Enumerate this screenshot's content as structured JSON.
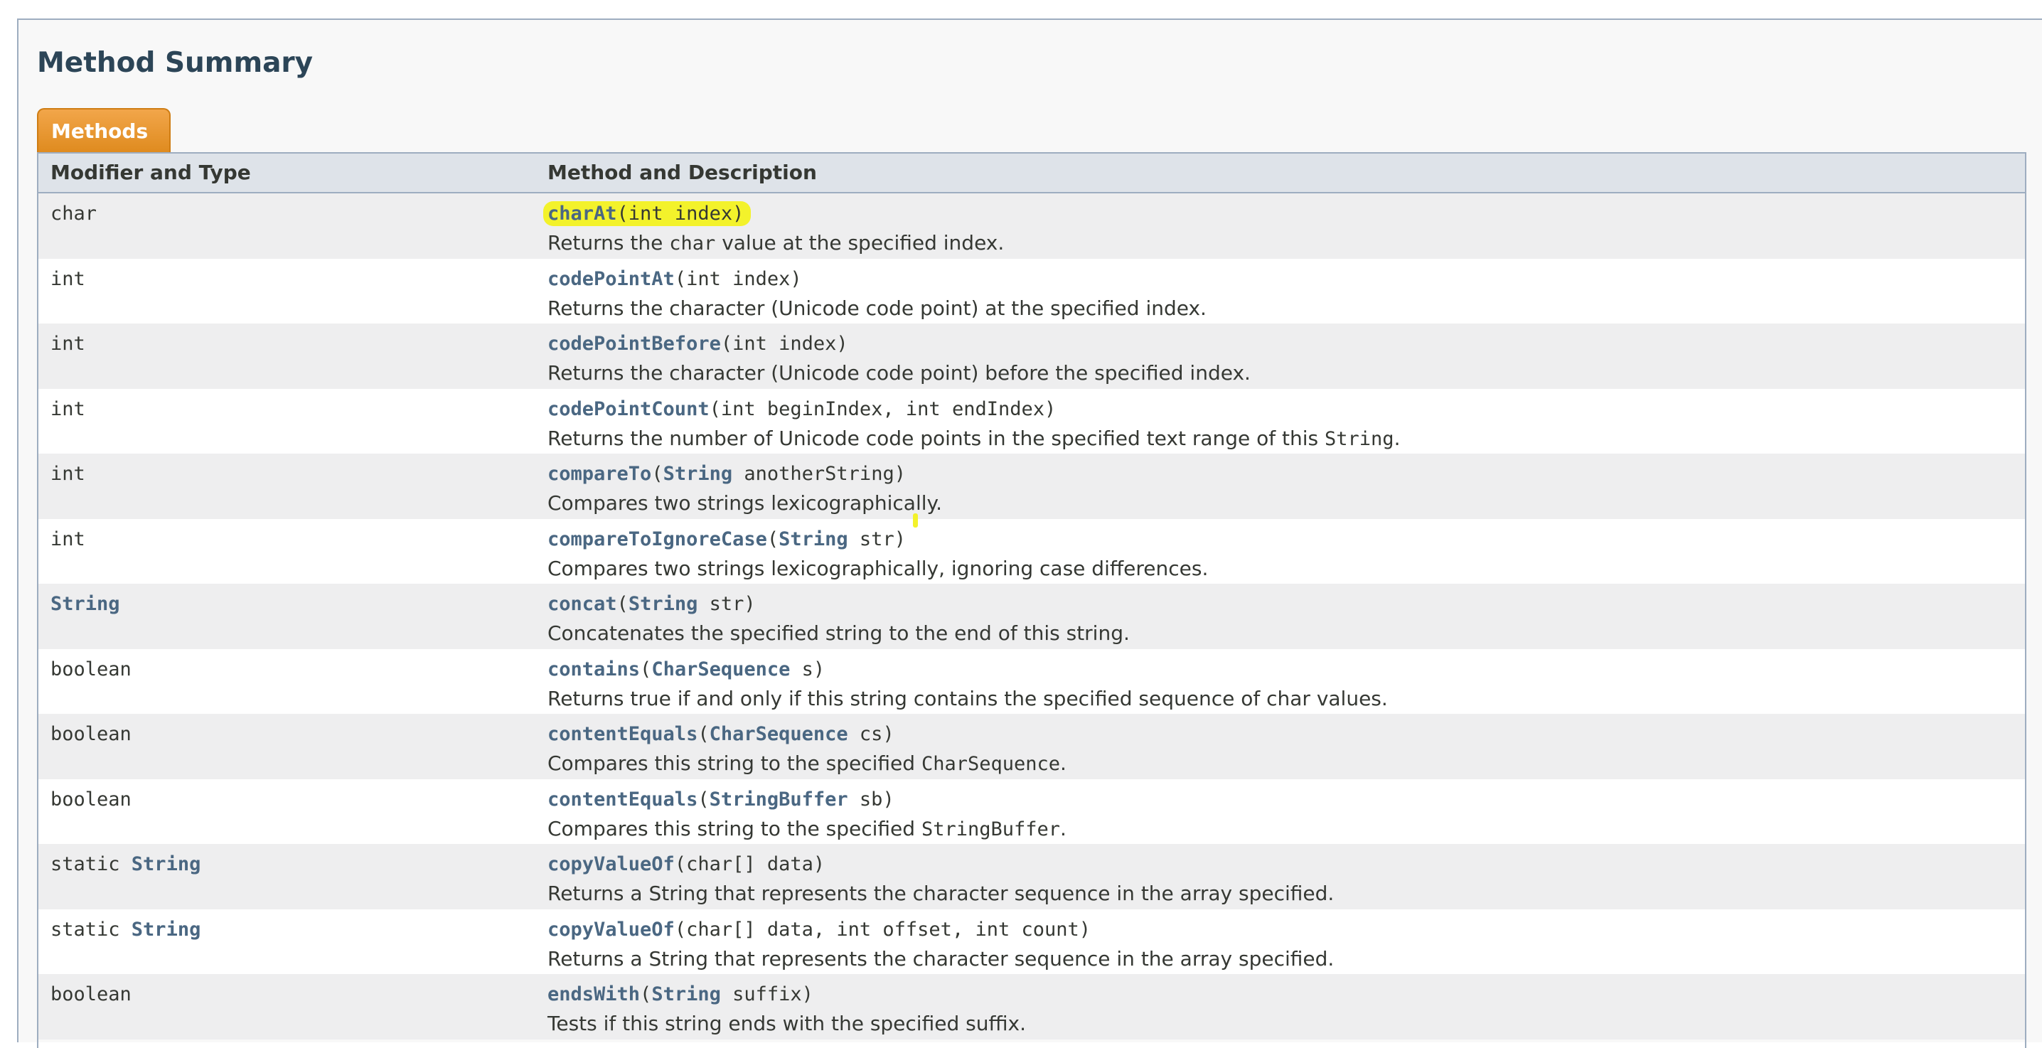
{
  "section": {
    "title": "Method Summary",
    "tab_label": "Methods"
  },
  "table": {
    "headers": [
      "Modifier and Type",
      "Method and Description"
    ],
    "rows": [
      {
        "modifier": [
          {
            "text": "char"
          }
        ],
        "method": [
          {
            "text": "charAt",
            "link": true
          },
          {
            "text": "(int index)"
          }
        ],
        "description": [
          {
            "text": "Returns the "
          },
          {
            "text": "char",
            "code": true
          },
          {
            "text": " value at the specified index."
          }
        ],
        "highlighted": true
      },
      {
        "modifier": [
          {
            "text": "int"
          }
        ],
        "method": [
          {
            "text": "codePointAt",
            "link": true
          },
          {
            "text": "(int index)"
          }
        ],
        "description": [
          {
            "text": "Returns the character (Unicode code point) at the specified index."
          }
        ]
      },
      {
        "modifier": [
          {
            "text": "int"
          }
        ],
        "method": [
          {
            "text": "codePointBefore",
            "link": true
          },
          {
            "text": "(int index)"
          }
        ],
        "description": [
          {
            "text": "Returns the character (Unicode code point) before the specified index."
          }
        ]
      },
      {
        "modifier": [
          {
            "text": "int"
          }
        ],
        "method": [
          {
            "text": "codePointCount",
            "link": true
          },
          {
            "text": "(int beginIndex, int endIndex)"
          }
        ],
        "description": [
          {
            "text": "Returns the number of Unicode code points in the specified text range of this "
          },
          {
            "text": "String",
            "code": true
          },
          {
            "text": "."
          }
        ]
      },
      {
        "modifier": [
          {
            "text": "int"
          }
        ],
        "method": [
          {
            "text": "compareTo",
            "link": true
          },
          {
            "text": "("
          },
          {
            "text": "String",
            "link": true
          },
          {
            "text": " anotherString)"
          }
        ],
        "description": [
          {
            "text": "Compares two strings lexicographically."
          }
        ]
      },
      {
        "modifier": [
          {
            "text": "int"
          }
        ],
        "method": [
          {
            "text": "compareToIgnoreCase",
            "link": true
          },
          {
            "text": "("
          },
          {
            "text": "String",
            "link": true
          },
          {
            "text": " str)"
          }
        ],
        "description": [
          {
            "text": "Compares two strings lexicographically, ignoring case differences."
          }
        ]
      },
      {
        "modifier": [
          {
            "text": "String",
            "link": true
          }
        ],
        "method": [
          {
            "text": "concat",
            "link": true
          },
          {
            "text": "("
          },
          {
            "text": "String",
            "link": true
          },
          {
            "text": " str)"
          }
        ],
        "description": [
          {
            "text": "Concatenates the specified string to the end of this string."
          }
        ]
      },
      {
        "modifier": [
          {
            "text": "boolean"
          }
        ],
        "method": [
          {
            "text": "contains",
            "link": true
          },
          {
            "text": "("
          },
          {
            "text": "CharSequence",
            "link": true
          },
          {
            "text": " s)"
          }
        ],
        "description": [
          {
            "text": "Returns true if and only if this string contains the specified sequence of char values."
          }
        ]
      },
      {
        "modifier": [
          {
            "text": "boolean"
          }
        ],
        "method": [
          {
            "text": "contentEquals",
            "link": true
          },
          {
            "text": "("
          },
          {
            "text": "CharSequence",
            "link": true
          },
          {
            "text": " cs)"
          }
        ],
        "description": [
          {
            "text": "Compares this string to the specified "
          },
          {
            "text": "CharSequence",
            "code": true
          },
          {
            "text": "."
          }
        ]
      },
      {
        "modifier": [
          {
            "text": "boolean"
          }
        ],
        "method": [
          {
            "text": "contentEquals",
            "link": true
          },
          {
            "text": "("
          },
          {
            "text": "StringBuffer",
            "link": true
          },
          {
            "text": " sb)"
          }
        ],
        "description": [
          {
            "text": "Compares this string to the specified "
          },
          {
            "text": "StringBuffer",
            "code": true
          },
          {
            "text": "."
          }
        ]
      },
      {
        "modifier": [
          {
            "text": "static "
          },
          {
            "text": "String",
            "link": true
          }
        ],
        "method": [
          {
            "text": "copyValueOf",
            "link": true
          },
          {
            "text": "(char[] data)"
          }
        ],
        "description": [
          {
            "text": "Returns a String that represents the character sequence in the array specified."
          }
        ]
      },
      {
        "modifier": [
          {
            "text": "static "
          },
          {
            "text": "String",
            "link": true
          }
        ],
        "method": [
          {
            "text": "copyValueOf",
            "link": true
          },
          {
            "text": "(char[] data, int offset, int count)"
          }
        ],
        "description": [
          {
            "text": "Returns a String that represents the character sequence in the array specified."
          }
        ]
      },
      {
        "modifier": [
          {
            "text": "boolean"
          }
        ],
        "method": [
          {
            "text": "endsWith",
            "link": true
          },
          {
            "text": "("
          },
          {
            "text": "String",
            "link": true
          },
          {
            "text": " suffix)"
          }
        ],
        "description": [
          {
            "text": "Tests if this string ends with the specified suffix."
          }
        ]
      }
    ]
  },
  "colors": {
    "link": "#4a6782",
    "highlight": "#f3f22b",
    "tab": "#e8951f",
    "header_bg": "#dee3e9",
    "alt_row_bg": "#eeeeef"
  }
}
